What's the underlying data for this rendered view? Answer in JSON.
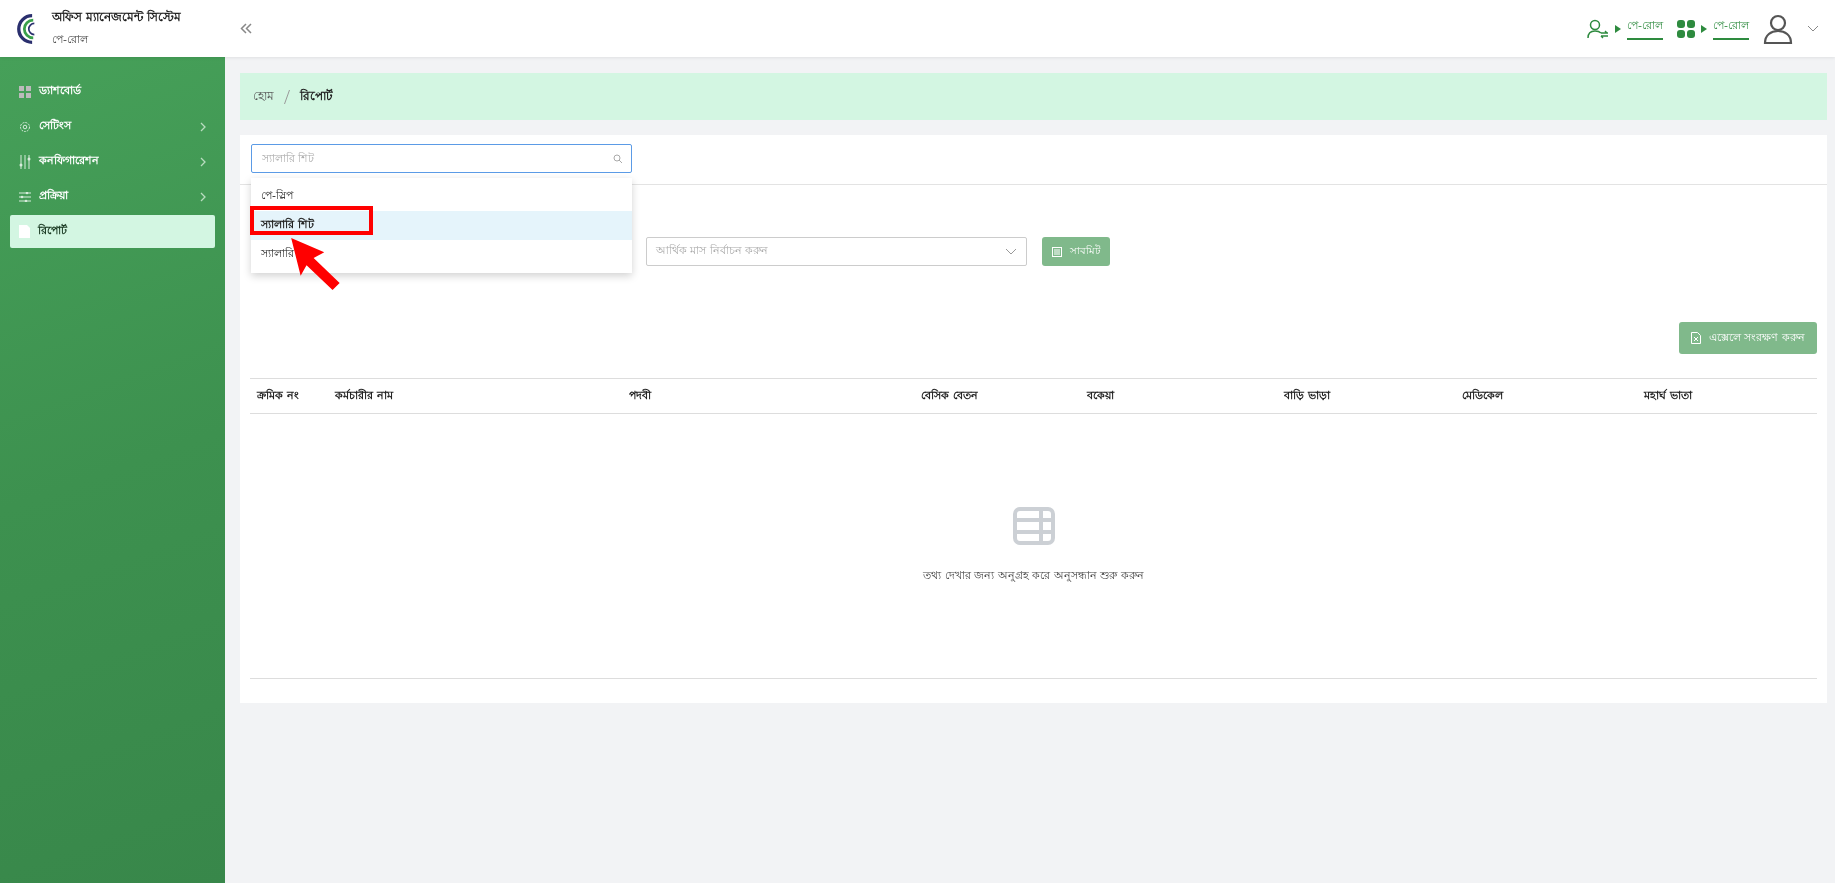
{
  "header": {
    "app_title": "অফিস ম্যানেজমেন্ট সিস্টেম",
    "app_subtitle": "পে-রোল",
    "links": [
      {
        "kind": "user-switch",
        "label": "পে-রোল"
      },
      {
        "kind": "apps",
        "label": "পে-রোল"
      }
    ]
  },
  "sidebar": {
    "items": [
      {
        "kind": "dashboard",
        "label": "ড্যাশবোর্ড",
        "has_submenu": false,
        "selected": false
      },
      {
        "kind": "settings",
        "label": "সেটিংস",
        "has_submenu": true,
        "selected": false
      },
      {
        "kind": "config",
        "label": "কনফিগারেশন",
        "has_submenu": true,
        "selected": false
      },
      {
        "kind": "process",
        "label": "প্রক্রিয়া",
        "has_submenu": true,
        "selected": false
      },
      {
        "kind": "report",
        "label": "রিপোর্ট",
        "has_submenu": false,
        "selected": true
      }
    ]
  },
  "breadcrumb": [
    {
      "label": "হোম",
      "current": false
    },
    {
      "label": "রিপোর্ট",
      "current": true
    }
  ],
  "report_select": {
    "placeholder": "স্যালারি শিট",
    "options": [
      {
        "label": "পে-স্লিপ",
        "selected": false
      },
      {
        "label": "স্যালারি শিট",
        "selected": true
      },
      {
        "label": "স্যালারি",
        "selected": false
      }
    ]
  },
  "month_select": {
    "placeholder": "আর্থিক মাস নির্বাচন করুন"
  },
  "submit_button": "সাবমিট",
  "excel_button": "এক্সেলে সংরক্ষণ করুন",
  "table": {
    "columns": [
      "ক্রমিক নং",
      "কর্মচারীর নাম",
      "পদবী",
      "বেসিক বেতন",
      "বকেয়া",
      "বাড়ি ভাড়া",
      "মেডিকেল",
      "মহার্ঘ ভাতা"
    ],
    "empty_message": "তথ্য দেখার জন্য অনুগ্রহ করে অনুসন্ধান শুরু করুন"
  }
}
